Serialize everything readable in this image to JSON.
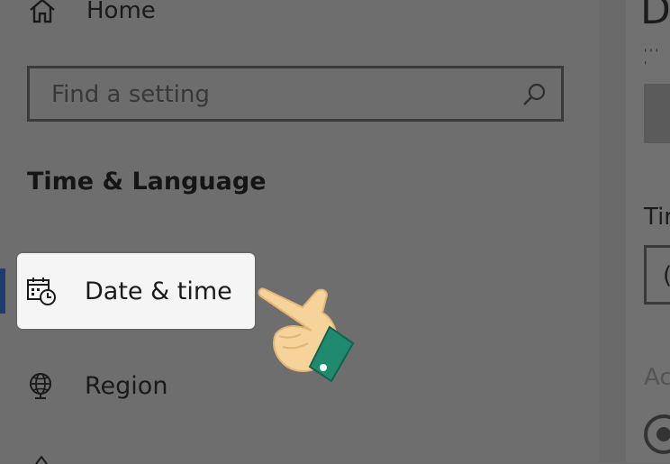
{
  "sidebar": {
    "home_label": "Home",
    "search": {
      "placeholder": "Find a setting",
      "value": ""
    },
    "section_heading": "Time & Language",
    "items": [
      {
        "label": "Date & time",
        "icon": "calendar-clock-icon",
        "selected": true
      },
      {
        "label": "Region",
        "icon": "globe-icon",
        "selected": false
      }
    ]
  },
  "right_pane": {
    "heading": "D",
    "subtext": "''' '",
    "label1": "Tir",
    "dropdown_value": "(",
    "label2": "Ac"
  },
  "colors": {
    "overlay_background": "#6e6e6e",
    "selected_item_background": "#f5f5f5",
    "active_indicator": "#1d3c70",
    "hand_skin": "#f6d39a",
    "hand_cuff": "#1f8a6e"
  }
}
